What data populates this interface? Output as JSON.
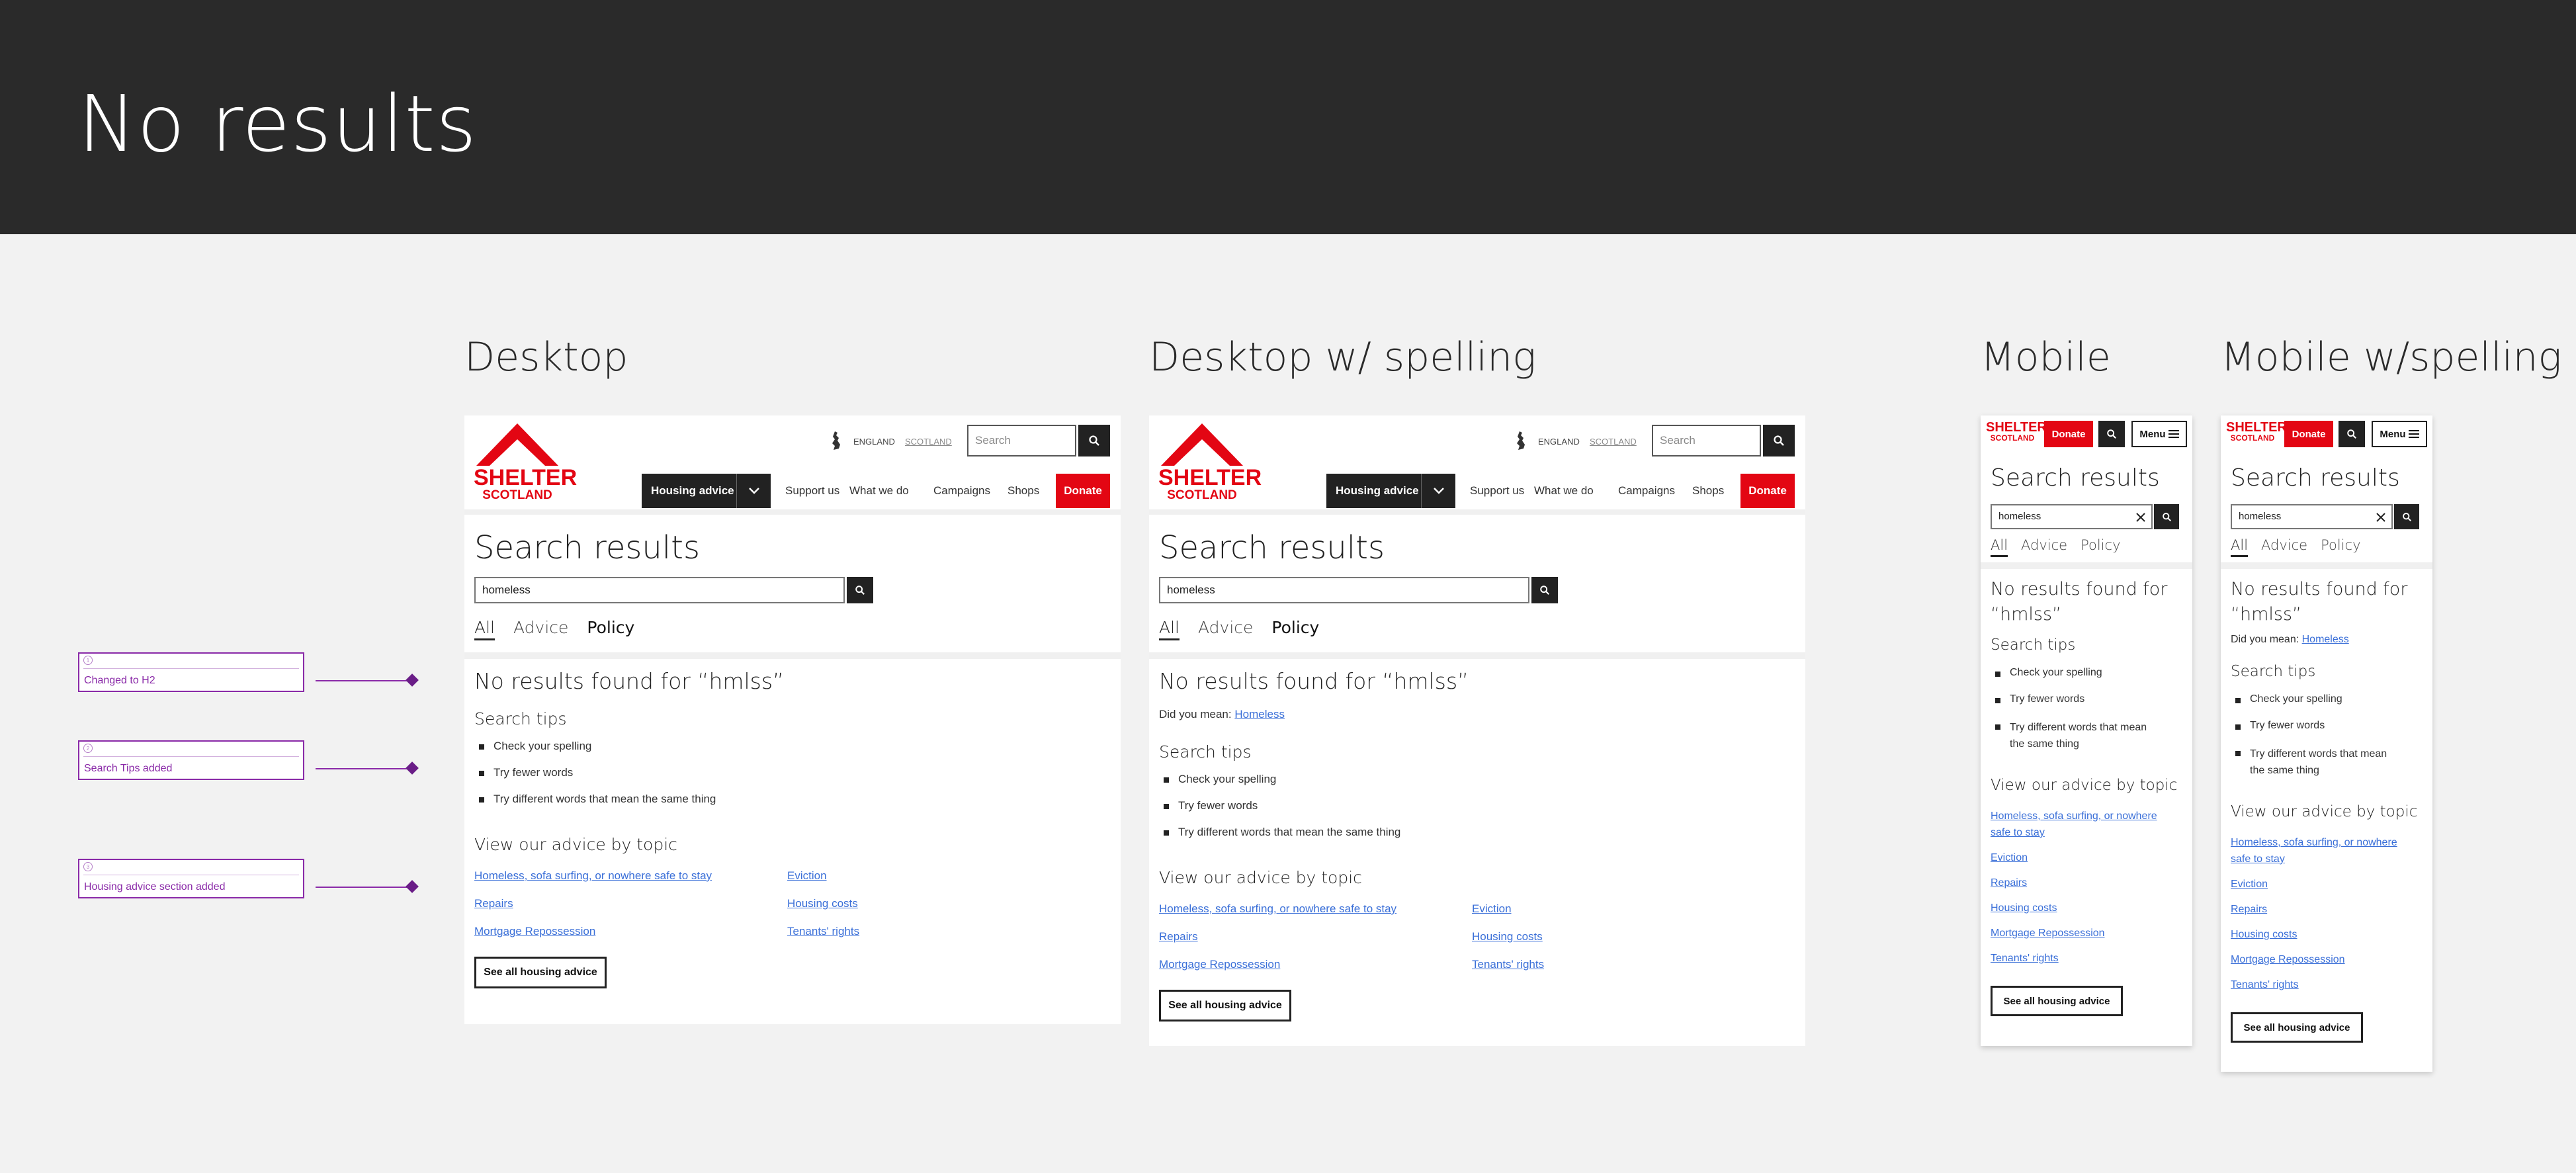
{
  "page_title": "No results",
  "columns": {
    "desktop": "Desktop",
    "desktop_spelling": "Desktop w/ spelling",
    "mobile": "Mobile",
    "mobile_spelling": "Mobile w/spelling"
  },
  "annotations": [
    {
      "label": "Changed to H2"
    },
    {
      "label": "Search Tips added"
    },
    {
      "label": "Housing advice section added"
    }
  ],
  "brand": {
    "line1": "SHELTER",
    "line2": "SCOTLAND",
    "color": "#e30613"
  },
  "header": {
    "england": "ENGLAND",
    "scotland": "SCOTLAND",
    "search_placeholder": "Search",
    "housing_advice": "Housing advice",
    "nav": [
      "Support us",
      "What we do",
      "Campaigns",
      "Shops"
    ],
    "donate": "Donate",
    "menu": "Menu"
  },
  "results": {
    "title": "Search results",
    "query": "homeless",
    "tabs": [
      "All",
      "Advice",
      "Policy"
    ],
    "no_results_desktop": "No results found for “hmlss”",
    "no_results_mobile_1": "No results found for",
    "no_results_mobile_2": "“hmlss”",
    "did_you_mean_label": "Did you mean:",
    "did_you_mean_link": "Homeless",
    "tips_title": "Search tips",
    "tips": [
      "Check your spelling",
      "Try fewer words",
      "Try different words that mean the same thing"
    ],
    "tips_mobile_3a": "Try different words that mean",
    "tips_mobile_3b": "the same thing",
    "advice_title": "View our advice by topic",
    "advice_links": [
      "Homeless, sofa surfing, or nowhere safe to stay",
      "Repairs",
      "Mortgage Repossession",
      "Eviction",
      "Housing costs",
      "Tenants' rights"
    ],
    "mobile_link_1a": "Homeless, sofa surfing, or nowhere",
    "mobile_link_1b": "safe to stay",
    "see_all": "See all housing advice"
  }
}
